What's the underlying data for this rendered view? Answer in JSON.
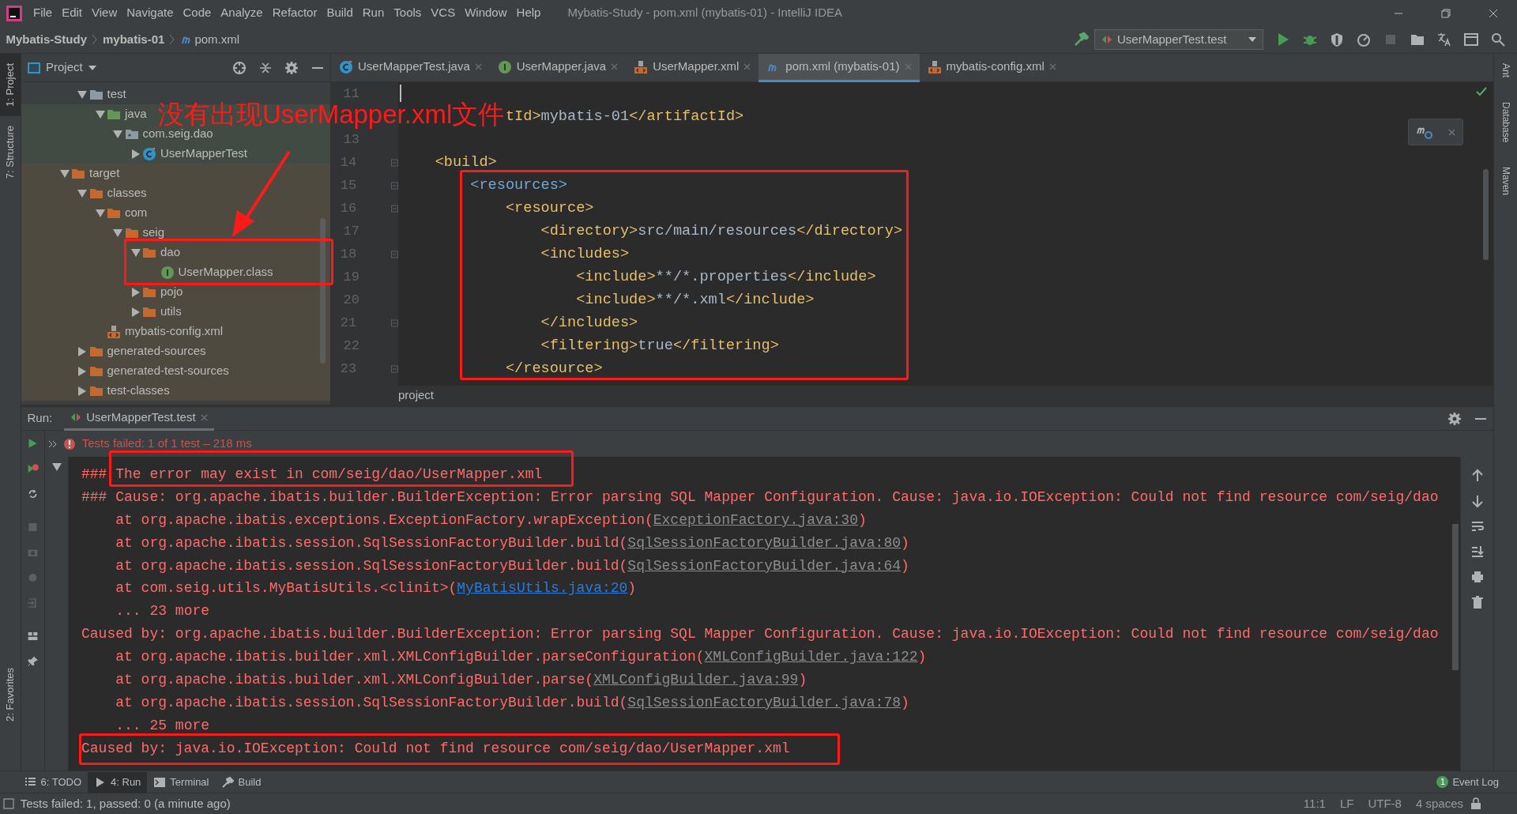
{
  "title_bar": {
    "menus": [
      "File",
      "Edit",
      "View",
      "Navigate",
      "Code",
      "Analyze",
      "Refactor",
      "Build",
      "Run",
      "Tools",
      "VCS",
      "Window",
      "Help"
    ],
    "title": "Mybatis-Study - pom.xml (mybatis-01) - IntelliJ IDEA"
  },
  "navigation": {
    "breadcrumbs": [
      {
        "label": "Mybatis-Study",
        "kind": "project"
      },
      {
        "label": "mybatis-01",
        "kind": "module"
      },
      {
        "label": "pom.xml",
        "kind": "maven"
      }
    ],
    "run_configuration": "UserMapperTest.test"
  },
  "left_stripe": [
    {
      "label": "1: Project",
      "selected": true
    },
    {
      "label": "7: Structure",
      "selected": false
    },
    {
      "label": "2: Favorites",
      "selected": false
    }
  ],
  "right_stripe": [
    "Ant",
    "Database",
    "Maven"
  ],
  "project_panel": {
    "title": "Project",
    "scrolled_parent_children": [
      {
        "label": "test",
        "kind": "folder",
        "expanded": true,
        "test_sources": false,
        "excluded": false,
        "children": [
          {
            "label": "java",
            "kind": "source-root",
            "expanded": true,
            "test_sources": true,
            "excluded": false,
            "children": [
              {
                "label": "com.seig.dao",
                "kind": "package",
                "expanded": true,
                "test_sources": true,
                "excluded": false,
                "children": [
                  {
                    "label": "UserMapperTest",
                    "kind": "class",
                    "expanded": false,
                    "test_sources": true,
                    "excluded": false
                  }
                ]
              }
            ]
          }
        ]
      }
    ],
    "items": [
      {
        "label": "target",
        "kind": "excluded-folder",
        "expanded": true,
        "test_sources": false,
        "excluded": true,
        "children": [
          {
            "label": "classes",
            "kind": "excluded-folder",
            "expanded": true,
            "test_sources": false,
            "excluded": true,
            "children": [
              {
                "label": "com",
                "kind": "excluded-folder",
                "expanded": true,
                "test_sources": false,
                "excluded": true,
                "children": [
                  {
                    "label": "seig",
                    "kind": "excluded-folder",
                    "expanded": true,
                    "test_sources": false,
                    "excluded": true,
                    "children": [
                      {
                        "label": "dao",
                        "kind": "excluded-folder",
                        "expanded": true,
                        "test_sources": false,
                        "excluded": true,
                        "children": [
                          {
                            "label": "UserMapper.class",
                            "kind": "interface",
                            "test_sources": false,
                            "excluded": true
                          }
                        ]
                      },
                      {
                        "label": "pojo",
                        "kind": "excluded-folder",
                        "expanded": false,
                        "test_sources": false,
                        "excluded": true
                      },
                      {
                        "label": "utils",
                        "kind": "excluded-folder",
                        "expanded": false,
                        "test_sources": false,
                        "excluded": true
                      }
                    ]
                  }
                ]
              },
              {
                "label": "mybatis-config.xml",
                "kind": "xml",
                "test_sources": false,
                "excluded": true
              }
            ]
          },
          {
            "label": "generated-sources",
            "kind": "excluded-folder",
            "expanded": false,
            "test_sources": false,
            "excluded": true
          },
          {
            "label": "generated-test-sources",
            "kind": "excluded-folder",
            "expanded": false,
            "test_sources": false,
            "excluded": true
          },
          {
            "label": "test-classes",
            "kind": "excluded-folder",
            "expanded": false,
            "test_sources": false,
            "excluded": true
          }
        ]
      }
    ]
  },
  "editor": {
    "tabs": [
      {
        "label": "UserMapperTest.java",
        "kind": "class",
        "selected": false
      },
      {
        "label": "UserMapper.java",
        "kind": "interface",
        "selected": false
      },
      {
        "label": "UserMapper.xml",
        "kind": "xml",
        "selected": false
      },
      {
        "label": "pom.xml (mybatis-01)",
        "kind": "maven",
        "selected": true
      },
      {
        "label": "mybatis-config.xml",
        "kind": "xml",
        "selected": false
      }
    ],
    "lines": [
      {
        "number": "11",
        "caret": true
      },
      {
        "tokens": [
          {
            "kind": "tag",
            "text": "            tId>"
          },
          {
            "kind": "text",
            "text": "mybatis-01"
          },
          {
            "kind": "tag",
            "text": "</artifactId>"
          }
        ]
      },
      {
        "number": "13"
      },
      {
        "number": "14",
        "fold": true,
        "tokens": [
          {
            "kind": "tag",
            "text": "    <build>"
          }
        ]
      },
      {
        "number": "15",
        "fold": true,
        "tokens": [
          {
            "kind": "matched",
            "text": "        <resources>"
          }
        ]
      },
      {
        "number": "16",
        "fold": true,
        "tokens": [
          {
            "kind": "tag",
            "text": "            <resource>"
          }
        ]
      },
      {
        "number": "17",
        "tokens": [
          {
            "kind": "tag",
            "text": "                <directory>"
          },
          {
            "kind": "text",
            "text": "src/main/resources"
          },
          {
            "kind": "tag",
            "text": "</directory>"
          }
        ]
      },
      {
        "number": "18",
        "fold": true,
        "tokens": [
          {
            "kind": "tag",
            "text": "                <includes>"
          }
        ]
      },
      {
        "number": "19",
        "tokens": [
          {
            "kind": "tag",
            "text": "                    <include>"
          },
          {
            "kind": "text",
            "text": "**/*.properties"
          },
          {
            "kind": "tag",
            "text": "</include>"
          }
        ]
      },
      {
        "number": "20",
        "tokens": [
          {
            "kind": "tag",
            "text": "                    <include>"
          },
          {
            "kind": "text",
            "text": "**/*.xml"
          },
          {
            "kind": "tag",
            "text": "</include>"
          }
        ]
      },
      {
        "number": "21",
        "fold": true,
        "tokens": [
          {
            "kind": "tag",
            "text": "                </includes>"
          }
        ]
      },
      {
        "number": "22",
        "tokens": [
          {
            "kind": "tag",
            "text": "                <filtering>"
          },
          {
            "kind": "text",
            "text": "true"
          },
          {
            "kind": "tag",
            "text": "</filtering>"
          }
        ]
      },
      {
        "number": "23",
        "fold": true,
        "tokens": [
          {
            "kind": "tag",
            "text": "            </resource>"
          }
        ]
      }
    ],
    "breadcrumb": "project"
  },
  "annotation": {
    "note": "没有出现UserMapper.xml文件"
  },
  "run": {
    "label": "Run:",
    "tab": "UserMapperTest.test",
    "status": "Tests failed: 1 of 1 test – 218 ms",
    "console": [
      {
        "segments": [
          {
            "kind": "error",
            "text": "### The error may exist in com/seig/dao/UserMapper.xml"
          }
        ]
      },
      {
        "segments": [
          {
            "kind": "error",
            "text": "### Cause: org.apache.ibatis.builder.BuilderException: Error parsing SQL Mapper Configuration. Cause: java.io.IOException: Could not find resource com/seig/dao"
          }
        ]
      },
      {
        "segments": [
          {
            "kind": "error",
            "text": "    at org.apache.ibatis.exceptions.ExceptionFactory.wrapException("
          },
          {
            "kind": "link",
            "text": "ExceptionFactory.java:30"
          },
          {
            "kind": "error",
            "text": ")"
          }
        ]
      },
      {
        "segments": [
          {
            "kind": "error",
            "text": "    at org.apache.ibatis.session.SqlSessionFactoryBuilder.build("
          },
          {
            "kind": "link",
            "text": "SqlSessionFactoryBuilder.java:80"
          },
          {
            "kind": "error",
            "text": ")"
          }
        ]
      },
      {
        "segments": [
          {
            "kind": "error",
            "text": "    at org.apache.ibatis.session.SqlSessionFactoryBuilder.build("
          },
          {
            "kind": "link",
            "text": "SqlSessionFactoryBuilder.java:64"
          },
          {
            "kind": "error",
            "text": ")"
          }
        ]
      },
      {
        "segments": [
          {
            "kind": "error",
            "text": "    at com.seig.utils.MyBatisUtils.<clinit>("
          },
          {
            "kind": "project-link",
            "text": "MyBatisUtils.java:20"
          },
          {
            "kind": "error",
            "text": ")"
          }
        ]
      },
      {
        "segments": [
          {
            "kind": "error",
            "text": "    ... 23 more"
          }
        ]
      },
      {
        "segments": [
          {
            "kind": "error",
            "text": "Caused by: org.apache.ibatis.builder.BuilderException: Error parsing SQL Mapper Configuration. Cause: java.io.IOException: Could not find resource com/seig/dao"
          }
        ]
      },
      {
        "segments": [
          {
            "kind": "error",
            "text": "    at org.apache.ibatis.builder.xml.XMLConfigBuilder.parseConfiguration("
          },
          {
            "kind": "link",
            "text": "XMLConfigBuilder.java:122"
          },
          {
            "kind": "error",
            "text": ")"
          }
        ]
      },
      {
        "segments": [
          {
            "kind": "error",
            "text": "    at org.apache.ibatis.builder.xml.XMLConfigBuilder.parse("
          },
          {
            "kind": "link",
            "text": "XMLConfigBuilder.java:99"
          },
          {
            "kind": "error",
            "text": ")"
          }
        ]
      },
      {
        "segments": [
          {
            "kind": "error",
            "text": "    at org.apache.ibatis.session.SqlSessionFactoryBuilder.build("
          },
          {
            "kind": "link",
            "text": "SqlSessionFactoryBuilder.java:78"
          },
          {
            "kind": "error",
            "text": ")"
          }
        ]
      },
      {
        "segments": [
          {
            "kind": "error",
            "text": "    ... 25 more"
          }
        ]
      },
      {
        "segments": [
          {
            "kind": "error",
            "text": "Caused by: java.io.IOException: Could not find resource com/seig/dao/UserMapper.xml"
          }
        ]
      }
    ]
  },
  "bottom_tools": [
    {
      "label": "6: TODO",
      "kind": "todo",
      "selected": false
    },
    {
      "label": "4: Run",
      "kind": "run",
      "selected": true
    },
    {
      "label": "Terminal",
      "kind": "terminal",
      "selected": false
    },
    {
      "label": "Build",
      "kind": "build",
      "selected": false
    }
  ],
  "event_log": {
    "label": "Event Log",
    "count": "1"
  },
  "status_bar": {
    "message": "Tests failed: 1, passed: 0 (a minute ago)",
    "items": [
      "11:1",
      "LF",
      "UTF-8",
      "4 spaces"
    ]
  }
}
